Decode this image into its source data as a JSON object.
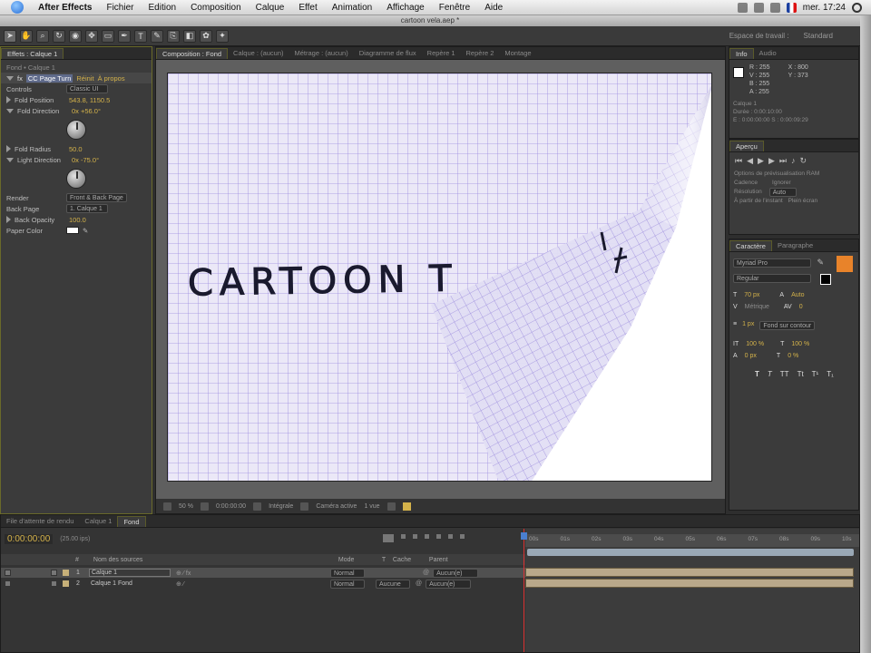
{
  "menubar": {
    "items": [
      "After Effects",
      "Fichier",
      "Edition",
      "Composition",
      "Calque",
      "Effet",
      "Animation",
      "Affichage",
      "Fenêtre",
      "Aide"
    ],
    "clock": "mer. 17:24"
  },
  "window": {
    "title": "cartoon vela.aep *"
  },
  "toolbar": {
    "workspace_label": "Espace de travail :",
    "workspace_value": "Standard"
  },
  "effects_panel": {
    "tab": "Effets : Calque 1",
    "layer_path": "Fond • Calque 1",
    "effect_name": "CC Page Turn",
    "reset": "Réinit",
    "about": "À propos",
    "rows": [
      {
        "label": "Controls",
        "value": "Classic UI"
      },
      {
        "label": "Fold Position",
        "value": "543.8, 1150.5"
      },
      {
        "label": "Fold Direction",
        "value": "0x +56.0°"
      },
      {
        "label": "Fold Radius",
        "value": "50.0"
      },
      {
        "label": "Light Direction",
        "value": "0x -75.0°"
      },
      {
        "label": "Render",
        "value": "Front & Back Page"
      },
      {
        "label": "Back Page",
        "value": "1. Calque 1"
      },
      {
        "label": "Back Opacity",
        "value": "100.0"
      },
      {
        "label": "Paper Color",
        "value": ""
      }
    ]
  },
  "viewer": {
    "tabs": [
      "Composition : Fond",
      "Calque : (aucun)",
      "Métrage : (aucun)",
      "Diagramme de flux",
      "Repère 1",
      "Repère 2",
      "Montage"
    ],
    "canvas_text": "CARTOON  T",
    "footer": {
      "zoom": "50 %",
      "timecode": "0:00:00:00",
      "resolution": "Intégrale",
      "camera": "Caméra active",
      "views": "1 vue"
    }
  },
  "info_panel": {
    "tabs": [
      "Info",
      "Audio"
    ],
    "values": [
      "R : 255",
      "V : 255",
      "B : 255",
      "A : 255",
      "X : 800",
      "Y : 373"
    ],
    "lines": [
      "Calque 1",
      "Durée : 0:00:10:00",
      "E : 0:00:00:00  S : 0:00:09:29"
    ]
  },
  "preview_panel": {
    "tab": "Aperçu",
    "lines": [
      "Options de prévisualisation RAM",
      "Cadence",
      "Ignorer",
      "Résolution",
      "Auto",
      "À partir de l'instant",
      "Plein écran"
    ]
  },
  "char_panel": {
    "tabs": [
      "Caractère",
      "Paragraphe"
    ],
    "font": "Myriad Pro",
    "style": "Regular",
    "size": "70 px",
    "leading": "Auto",
    "tracking": "0",
    "kerning": "Métrique",
    "vscale": "100 %",
    "hscale": "100 %",
    "baseline": "0 px",
    "tsume": "0 %",
    "stroke_width": "1 px",
    "stroke_mode": "Fond sur contour",
    "style_buttons": [
      "T",
      "T",
      "TT",
      "Tt",
      "T¹",
      "T₁"
    ],
    "fill_color": "#e8832a"
  },
  "timeline": {
    "tabs": [
      "File d'attente de rendu",
      "Calque 1",
      "Fond"
    ],
    "timecode": "0:00:00:00",
    "fps": "(25.00 ips)",
    "columns": [
      "#",
      "Nom des sources",
      "Mode",
      "T",
      "Cache",
      "Parent"
    ],
    "layers": [
      {
        "index": "1",
        "name": "Calque 1",
        "mode": "Normal",
        "trkmat": "",
        "parent": "Aucun(e)"
      },
      {
        "index": "2",
        "name": "Calque 1 Fond",
        "mode": "Normal",
        "trkmat": "Aucune",
        "parent": "Aucun(e)"
      }
    ],
    "ruler_ticks": [
      "00s",
      "01s",
      "02s",
      "03s",
      "04s",
      "05s",
      "06s",
      "07s",
      "08s",
      "09s",
      "10s"
    ]
  },
  "colors": {
    "accent": "#d4b24a",
    "playhead": "#dd3333",
    "paper_grid": "#8f7fd6"
  },
  "icons": [
    "apple-icon",
    "search-icon",
    "flag-icon",
    "gear-icon"
  ]
}
